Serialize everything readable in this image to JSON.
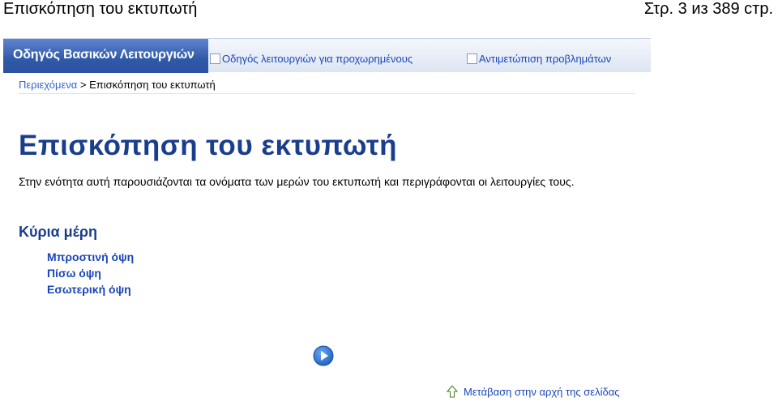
{
  "header": {
    "title": "Επισκόπηση του εκτυπωτή",
    "page_counter": "Στρ. 3 из 389 стр."
  },
  "nav": {
    "active_tab": "Οδηγός Βασικών Λειτουργιών",
    "tabs": [
      {
        "label": "Οδηγός λειτουργιών για προχωρημένους"
      },
      {
        "label": "Αντιμετώπιση προβλημάτων"
      }
    ]
  },
  "breadcrumb": {
    "root": "Περιεχόμενα",
    "separator": ">",
    "current": "Επισκόπηση του εκτυπωτή"
  },
  "main": {
    "title": "Επισκόπηση του εκτυπωτή",
    "intro": "Στην ενότητα αυτή παρουσιάζονται τα ονόματα των μερών του εκτυπωτή και περιγράφονται οι λειτουργίες τους.",
    "section_title": "Κύρια μέρη",
    "links": [
      {
        "label": "Μπροστινή όψη"
      },
      {
        "label": "Πίσω όψη"
      },
      {
        "label": "Εσωτερική όψη"
      }
    ]
  },
  "footer": {
    "back_to_top": "Μετάβαση στην αρχή της σελίδας"
  },
  "colors": {
    "title_blue": "#1a3e8c",
    "link_blue": "#1a46b8",
    "nav_active": "#2f5aa8",
    "button_blue": "#1f6fd0"
  },
  "icons": {
    "next": "play-circle-icon",
    "back_to_top": "arrow-up-icon"
  }
}
